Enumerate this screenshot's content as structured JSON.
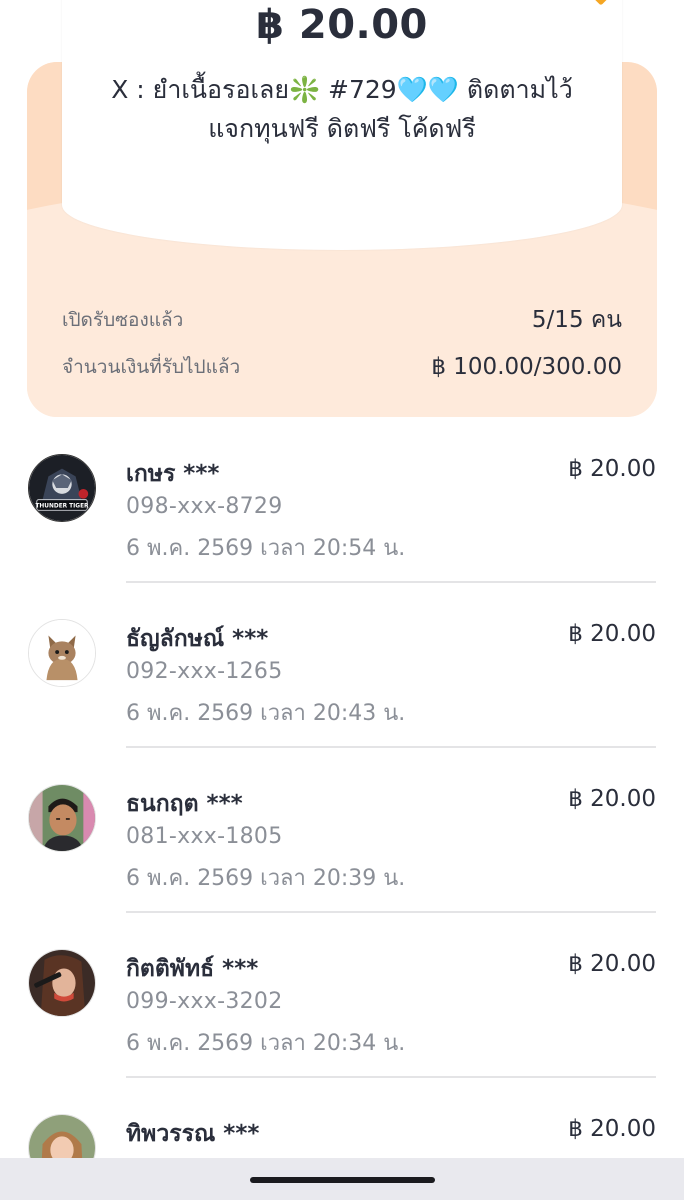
{
  "envelope": {
    "amount": "฿ 20.00",
    "message_line1": "X : ยำเนื้อรอเลย❇️ #729🩵🩵 ติดตามไว้",
    "message_line2": "แจกทุนฟรี ดิตฟรี โค้ดฟรี",
    "opened_label": "เปิดรับซองแล้ว",
    "opened_value": "5/15 คน",
    "received_label": "จำนวนเงินที่รับไปแล้ว",
    "received_value": "฿ 100.00/300.00"
  },
  "recipients": [
    {
      "name": "เกษร ***",
      "phone": "098-xxx-8729",
      "time": "6 พ.ค. 2569 เวลา 20:54 น.",
      "amount": "฿ 20.00",
      "avatar_icon": "thunder-tiger-logo",
      "avatar_text": "THUNDER TIGER"
    },
    {
      "name": "ธัญลักษณ์ ***",
      "phone": "092-xxx-1265",
      "time": "6 พ.ค. 2569 เวลา 20:43 น.",
      "amount": "฿ 20.00",
      "avatar_icon": "cat-photo"
    },
    {
      "name": "ธนกฤต ***",
      "phone": "081-xxx-1805",
      "time": "6 พ.ค. 2569 เวลา 20:39 น.",
      "amount": "฿ 20.00",
      "avatar_icon": "person-photo"
    },
    {
      "name": "กิตติพัทธ์ ***",
      "phone": "099-xxx-3202",
      "time": "6 พ.ค. 2569 เวลา 20:34 น.",
      "amount": "฿ 20.00",
      "avatar_icon": "person-photo"
    },
    {
      "name": "ทิพวรรณ ***",
      "amount": "฿ 20.00",
      "avatar_icon": "person-photo"
    }
  ],
  "colors": {
    "envelope_background": "#feeadb",
    "envelope_flap": "#fddcc2",
    "text_primary": "#2a2e3b",
    "text_secondary": "#8b8f97"
  }
}
